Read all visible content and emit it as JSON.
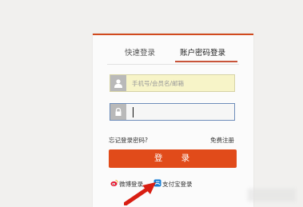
{
  "tabs": {
    "quick_login": "快速登录",
    "account_login": "账户密码登录"
  },
  "username_field": {
    "placeholder": "手机号/会员名/邮箱",
    "icon": "user-icon"
  },
  "password_field": {
    "icon": "lock-icon"
  },
  "links": {
    "forgot_password": "忘记登录密码?",
    "register": "免费注册"
  },
  "login_button": {
    "label": "登 录"
  },
  "social_logins": {
    "weibo": "微博登录",
    "alipay": "支付宝登录"
  },
  "colors": {
    "accent": "#e14b1a",
    "username_bg": "#f7f4c8",
    "password_border": "#6e8dba"
  }
}
